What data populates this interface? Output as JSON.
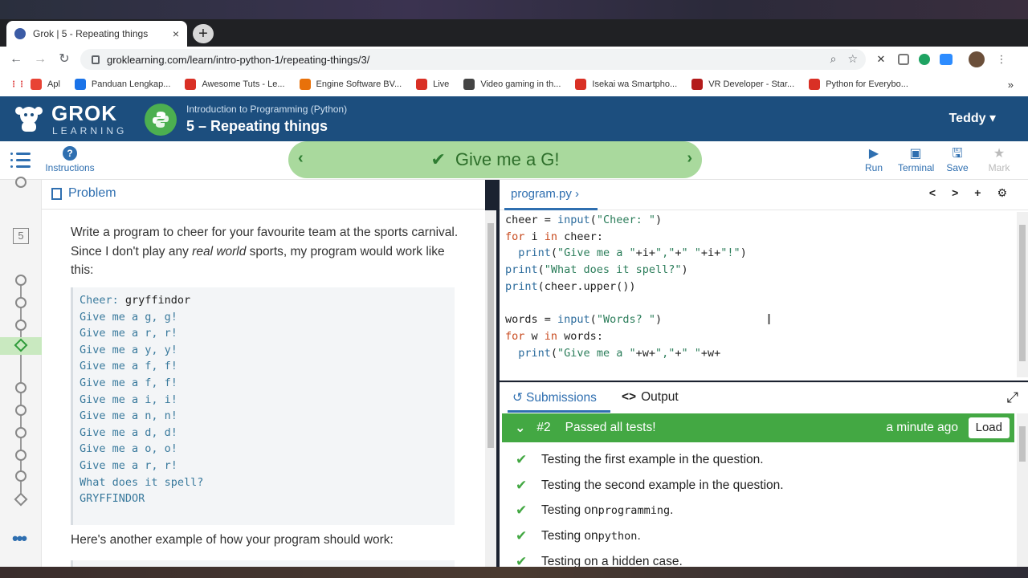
{
  "browser": {
    "tab_title": "Grok | 5 - Repeating things",
    "tab_close": "×",
    "new_tab": "+",
    "url": "groklearning.com/learn/intro-python-1/repeating-things/3/",
    "bookmarks": [
      {
        "label": "Apl",
        "color": "#e84335"
      },
      {
        "label": "Panduan Lengkap...",
        "color": "#1a73e8"
      },
      {
        "label": "Awesome Tuts - Le...",
        "color": "#d93025"
      },
      {
        "label": "Engine Software BV...",
        "color": "#e8710a"
      },
      {
        "label": "Live",
        "color": "#d93025"
      },
      {
        "label": "Video gaming in th...",
        "color": "#444444"
      },
      {
        "label": "Isekai wa Smartpho...",
        "color": "#d93025"
      },
      {
        "label": "VR Developer - Star...",
        "color": "#b31b1b"
      },
      {
        "label": "Python for Everybo...",
        "color": "#d93025"
      }
    ],
    "more_bookmarks": "»"
  },
  "header": {
    "logo": "GROK",
    "logo_sub": "LEARNING",
    "course": "Introduction to Programming (Python)",
    "module": "5 – Repeating things",
    "user": "Teddy ▾"
  },
  "subbar": {
    "instructions": "Instructions",
    "problem_title": "Give me a G!",
    "tools": [
      {
        "label": "Run",
        "icon": "play-icon",
        "glyph": "▶",
        "enabled": true
      },
      {
        "label": "Terminal",
        "icon": "terminal-icon",
        "glyph": "▣",
        "enabled": true
      },
      {
        "label": "Save",
        "icon": "save-icon",
        "glyph": "🖫",
        "enabled": true
      },
      {
        "label": "Mark",
        "icon": "star-icon",
        "glyph": "★",
        "enabled": false
      }
    ]
  },
  "rail": {
    "number": "5"
  },
  "problem": {
    "tab": "Problem",
    "intro_1": "Write a program to cheer for your favourite team at the sports carnival. Since I don't play any ",
    "intro_em": "real world",
    "intro_2": " sports, my program would work like this:",
    "example_prompt": "Cheer: ",
    "example_input": "gryffindor",
    "example_lines": [
      "Give me a g, g!",
      "Give me a r, r!",
      "Give me a y, y!",
      "Give me a f, f!",
      "Give me a f, f!",
      "Give me a i, i!",
      "Give me a n, n!",
      "Give me a d, d!",
      "Give me a o, o!",
      "Give me a r, r!",
      "What does it spell?",
      "GRYFFINDOR"
    ],
    "another": "Here's another example of how your program should work:"
  },
  "editor": {
    "filename": "program.py",
    "code": [
      [
        {
          "t": "cheer = ",
          "c": "op"
        },
        {
          "t": "input",
          "c": "fn"
        },
        {
          "t": "(",
          "c": "op"
        },
        {
          "t": "\"Cheer: \"",
          "c": "str"
        },
        {
          "t": ")",
          "c": "op"
        }
      ],
      [
        {
          "t": "for",
          "c": "kw"
        },
        {
          "t": " i ",
          "c": "op"
        },
        {
          "t": "in",
          "c": "kw"
        },
        {
          "t": " cheer:",
          "c": "op"
        }
      ],
      [
        {
          "t": "  ",
          "c": "op"
        },
        {
          "t": "print",
          "c": "fn"
        },
        {
          "t": "(",
          "c": "op"
        },
        {
          "t": "\"Give me a \"",
          "c": "str"
        },
        {
          "t": "+i+",
          "c": "op"
        },
        {
          "t": "\",\"",
          "c": "str"
        },
        {
          "t": "+",
          "c": "op"
        },
        {
          "t": "\" \"",
          "c": "str"
        },
        {
          "t": "+i+",
          "c": "op"
        },
        {
          "t": "\"!\"",
          "c": "str"
        },
        {
          "t": ")",
          "c": "op"
        }
      ],
      [
        {
          "t": "print",
          "c": "fn"
        },
        {
          "t": "(",
          "c": "op"
        },
        {
          "t": "\"What does it spell?\"",
          "c": "str"
        },
        {
          "t": ")",
          "c": "op"
        }
      ],
      [
        {
          "t": "print",
          "c": "fn"
        },
        {
          "t": "(cheer.upper())",
          "c": "op"
        }
      ],
      [
        {
          "t": "",
          "c": "op"
        }
      ],
      [
        {
          "t": "words = ",
          "c": "op"
        },
        {
          "t": "input",
          "c": "fn"
        },
        {
          "t": "(",
          "c": "op"
        },
        {
          "t": "\"Words? \"",
          "c": "str"
        },
        {
          "t": ")",
          "c": "op"
        }
      ],
      [
        {
          "t": "for",
          "c": "kw"
        },
        {
          "t": " w ",
          "c": "op"
        },
        {
          "t": "in",
          "c": "kw"
        },
        {
          "t": " words:",
          "c": "op"
        }
      ],
      [
        {
          "t": "  ",
          "c": "op"
        },
        {
          "t": "print",
          "c": "fn"
        },
        {
          "t": "(",
          "c": "op"
        },
        {
          "t": "\"Give me a \"",
          "c": "str"
        },
        {
          "t": "+w+",
          "c": "op"
        },
        {
          "t": "\",\"",
          "c": "str"
        },
        {
          "t": "+",
          "c": "op"
        },
        {
          "t": "\" \"",
          "c": "str"
        },
        {
          "t": "+w+",
          "c": "op"
        }
      ]
    ]
  },
  "submissions": {
    "tab_submissions": "Submissions",
    "tab_output": "Output",
    "number": "#2",
    "status": "Passed all tests!",
    "time": "a minute ago",
    "load": "Load",
    "tests": [
      {
        "text": "Testing the first example in the question.",
        "code": "",
        "suffix": ""
      },
      {
        "text": "Testing the second example in the question.",
        "code": "",
        "suffix": ""
      },
      {
        "text": "Testing on ",
        "code": "programming",
        "suffix": "."
      },
      {
        "text": "Testing on ",
        "code": "python",
        "suffix": "."
      },
      {
        "text": "Testing on a hidden case.",
        "code": "",
        "suffix": ""
      }
    ]
  },
  "colors": {
    "header": "#1c4e7e",
    "accent": "#2f6fb0",
    "pass": "#43a843",
    "problem_banner": "#a9d99d"
  }
}
